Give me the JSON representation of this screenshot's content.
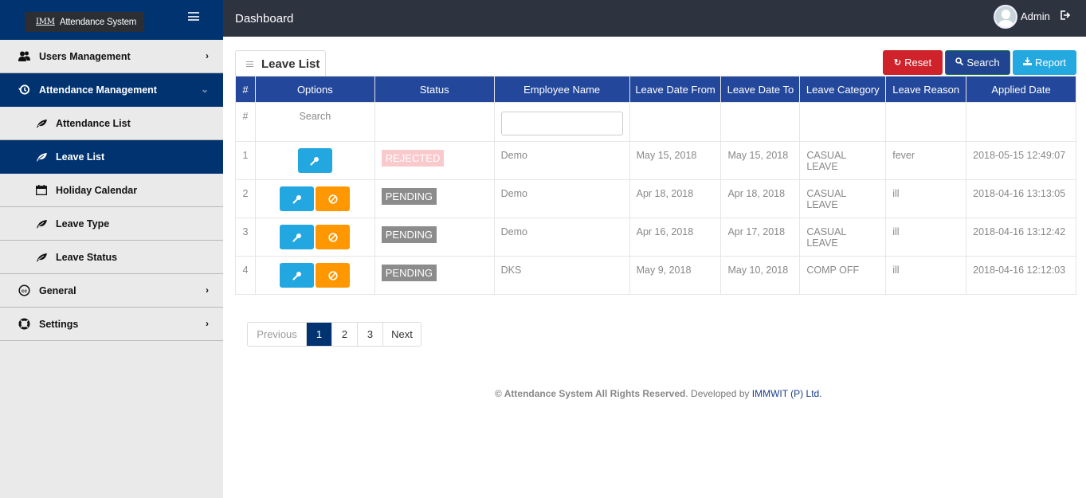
{
  "brand": {
    "logo": "IMM",
    "name": "Attendance System"
  },
  "topbar": {
    "title": "Dashboard",
    "user": "Admin"
  },
  "sidebar": {
    "items": [
      {
        "label": "Users Management",
        "icon": "users-icon",
        "level": "top",
        "chevron": "›",
        "active": false
      },
      {
        "label": "Attendance Management",
        "icon": "history-icon",
        "level": "top",
        "chevron": "⌄",
        "active": true
      },
      {
        "label": "Attendance List",
        "icon": "leaf-icon",
        "level": "sub",
        "active": false
      },
      {
        "label": "Leave List",
        "icon": "leaf-icon",
        "level": "sub",
        "active": true
      },
      {
        "label": "Holiday Calendar",
        "icon": "calendar-icon",
        "level": "sub",
        "active": false
      },
      {
        "label": "Leave Type",
        "icon": "leaf-icon",
        "level": "sub",
        "active": false
      },
      {
        "label": "Leave Status",
        "icon": "leaf-icon",
        "level": "sub",
        "active": false
      },
      {
        "label": "General",
        "icon": "creative-commons-icon",
        "level": "top",
        "chevron": "›",
        "active": false
      },
      {
        "label": "Settings",
        "icon": "life-ring-icon",
        "level": "top",
        "chevron": "›",
        "active": false
      }
    ]
  },
  "panel": {
    "title": "Leave List"
  },
  "toolbar": {
    "reset": "Reset",
    "search": "Search",
    "report": "Report"
  },
  "table": {
    "headers": [
      "#",
      "Options",
      "Status",
      "Employee Name",
      "Leave Date From",
      "Leave Date To",
      "Leave Category",
      "Leave Reason",
      "Applied Date"
    ],
    "filter": {
      "num": "#",
      "options": "Search",
      "employee_value": "",
      "employee_placeholder": ""
    },
    "rows": [
      {
        "num": "1",
        "status": "REJECTED",
        "employee": "Demo",
        "from": "May 15, 2018",
        "to": "May 15, 2018",
        "category": "CASUAL LEAVE",
        "reason": "fever",
        "applied": "2018-05-15 12:49:07"
      },
      {
        "num": "2",
        "status": "PENDING",
        "employee": "Demo",
        "from": "Apr 18, 2018",
        "to": "Apr 18, 2018",
        "category": "CASUAL LEAVE",
        "reason": "ill",
        "applied": "2018-04-16 13:13:05"
      },
      {
        "num": "3",
        "status": "PENDING",
        "employee": "Demo",
        "from": "Apr 16, 2018",
        "to": "Apr 17, 2018",
        "category": "CASUAL LEAVE",
        "reason": "ill",
        "applied": "2018-04-16 13:12:42"
      },
      {
        "num": "4",
        "status": "PENDING",
        "employee": "DKS",
        "from": "May 9, 2018",
        "to": "May 10, 2018",
        "category": "COMP OFF",
        "reason": "ill",
        "applied": "2018-04-16 12:12:03"
      }
    ]
  },
  "pagination": {
    "prev": "Previous",
    "pages": [
      "1",
      "2",
      "3"
    ],
    "current": "1",
    "next": "Next"
  },
  "footer": {
    "copyright": "© Attendance System All Rights Reserved",
    "developed_by": ". Developed by ",
    "company": "IMMWIT (P) Ltd."
  },
  "colors": {
    "primary": "#003370",
    "header": "#23479a",
    "reset": "#d0222a",
    "info": "#22a7e0",
    "warning": "#ff9800",
    "rejected": "#f9c9cc",
    "pending": "#8c8c8c"
  }
}
